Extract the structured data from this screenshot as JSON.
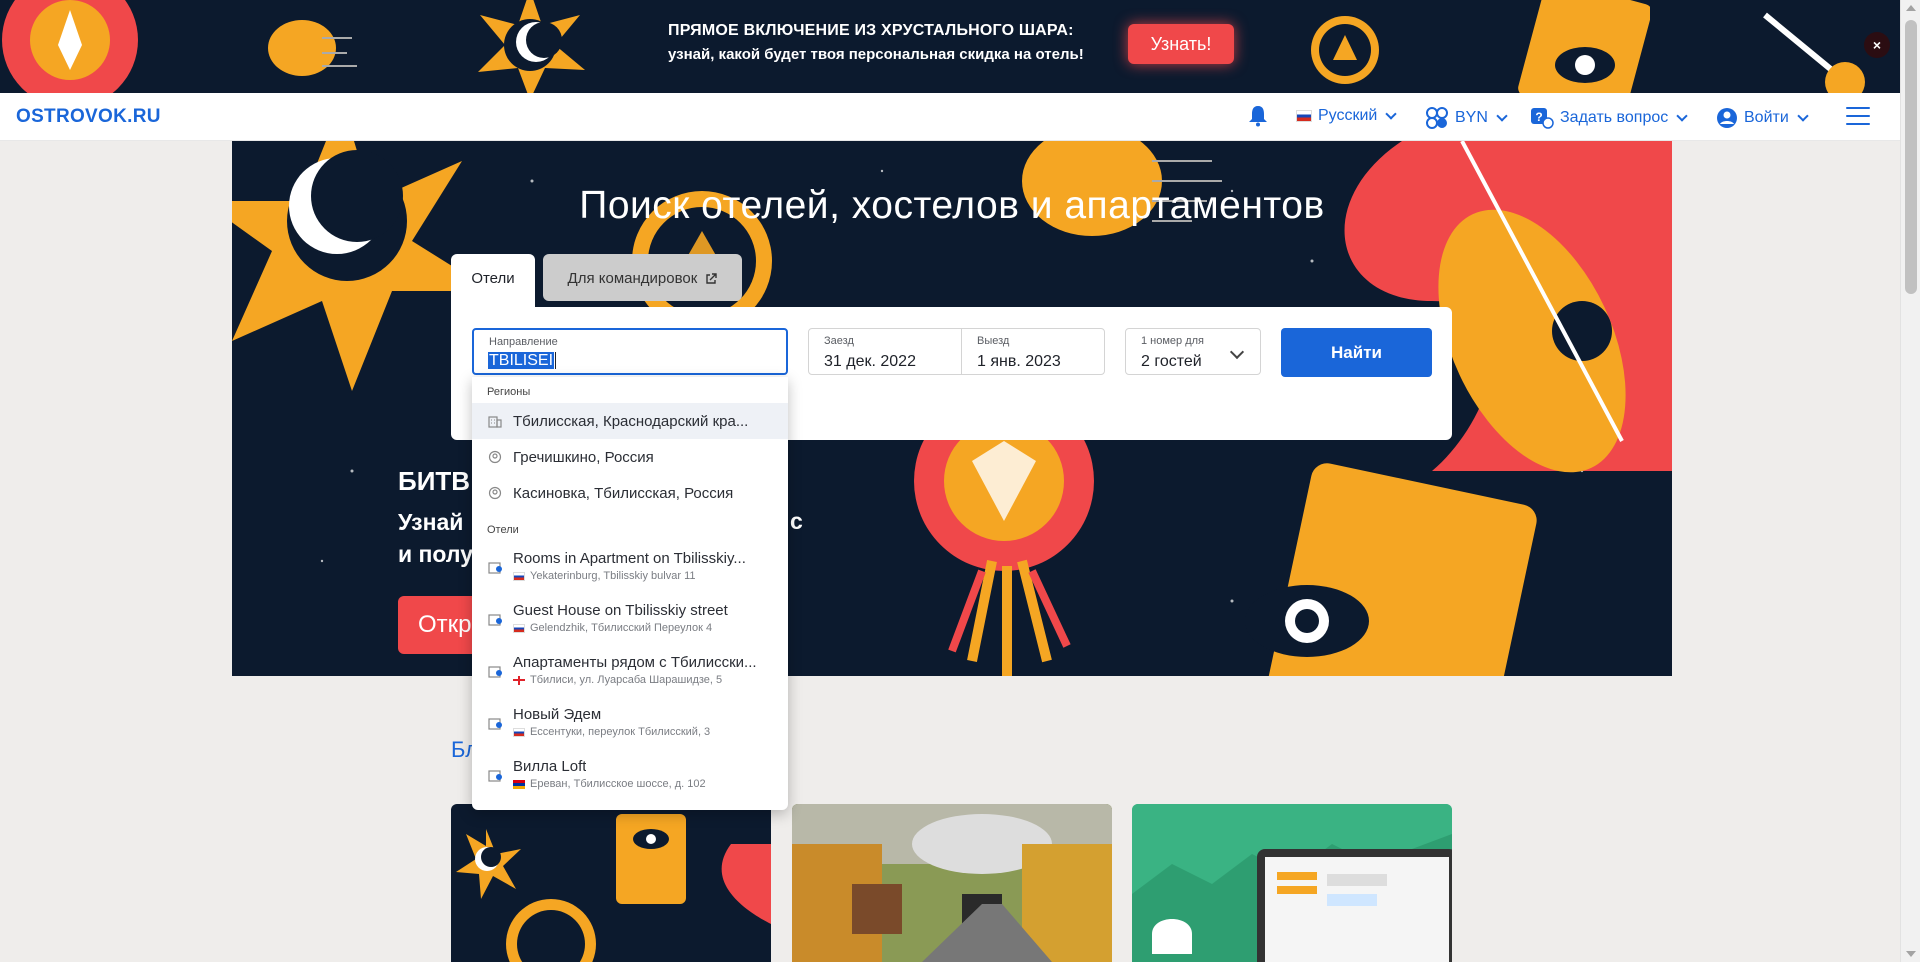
{
  "promo_banner": {
    "title": "ПРЯМОЕ ВКЛЮЧЕНИЕ ИЗ ХРУСТАЛЬНОГО ШАРА:",
    "subtitle": "узнай, какой будет твоя персональная скидка на отель!",
    "button_label": "Узнать!",
    "close_label": "×"
  },
  "header": {
    "logo": "OSTROVOK.RU",
    "language": "Русский",
    "currency": "BYN",
    "ask_question": "Задать вопрос",
    "login": "Войти"
  },
  "hero": {
    "title": "Поиск отелей, хостелов и апартаментов",
    "tabs": [
      {
        "label": "Отели",
        "active": true
      },
      {
        "label": "Для командировок",
        "active": false
      }
    ]
  },
  "search": {
    "destination_label": "Направление",
    "destination_value": "TBILISEI",
    "checkin_label": "Заезд",
    "checkin_value": "31 дек. 2022",
    "checkout_label": "Выезд",
    "checkout_value": "1 янв. 2023",
    "rooms_label": "1 номер для",
    "guests_value": "2 гостей",
    "find_button": "Найти"
  },
  "dropdown": {
    "regions_header": "Регионы",
    "regions": [
      {
        "label": "Тбилисская, Краснодарский кра...",
        "icon": "building-icon"
      },
      {
        "label": "Гречишкино, Россия",
        "icon": "pin-icon"
      },
      {
        "label": "Касиновка, Тбилисская, Россия",
        "icon": "pin-icon"
      }
    ],
    "hotels_header": "Отели",
    "hotels": [
      {
        "name": "Rooms in Apartment on Tbilisskiy...",
        "address": "Yekaterinburg, Tbilisskiy bulvar 11",
        "flag": "ru"
      },
      {
        "name": "Guest House on Tbilisskiy street",
        "address": "Gelendzhik, Тбилисский Переулок 4",
        "flag": "ru"
      },
      {
        "name": "Апартаменты рядом с Тбилисски...",
        "address": "Тбилиси, ул. Луарсаба Шарашидзе, 5",
        "flag": "ge"
      },
      {
        "name": "Новый Эдем",
        "address": "Ессентуки, переулок Тбилисский, 3",
        "flag": "ru"
      },
      {
        "name": "Вилла Loft",
        "address": "Ереван, Тбилисское шоссе, д. 102",
        "flag": "am"
      }
    ]
  },
  "promo_section": {
    "title": "БИТВ",
    "subtitle_line1": "Узнай",
    "subtitle_line2": "и полу",
    "subtitle_tail": "с",
    "button": "Откр"
  },
  "blog": {
    "label": "Бл"
  },
  "colors": {
    "brand": "#1a66d9",
    "accent": "#f0484a",
    "hero_bg": "#0c1a2e",
    "yellow": "#f5a623"
  }
}
